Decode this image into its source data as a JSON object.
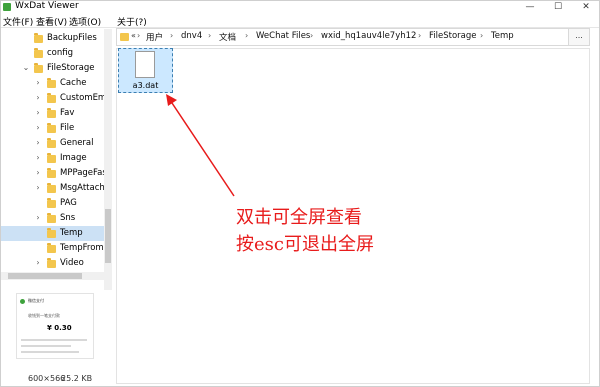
{
  "window": {
    "title": "WxDat Viewer",
    "controls": {
      "minimize": "—",
      "maximize": "☐",
      "close": "✕"
    }
  },
  "menu": [
    {
      "label": "文件(F)"
    },
    {
      "label": "查看(V)"
    },
    {
      "label": "选项(O)"
    },
    {
      "label": "关于(?)"
    }
  ],
  "tree": {
    "items": [
      {
        "label": "BackupFiles",
        "arrow": "",
        "selected": false
      },
      {
        "label": "config",
        "arrow": "",
        "selected": false
      },
      {
        "label": "FileStorage",
        "arrow": "⌄",
        "selected": false
      },
      {
        "label": "Cache",
        "arrow": "›",
        "selected": false
      },
      {
        "label": "CustomEmo",
        "arrow": "›",
        "selected": false
      },
      {
        "label": "Fav",
        "arrow": "›",
        "selected": false
      },
      {
        "label": "File",
        "arrow": "›",
        "selected": false
      },
      {
        "label": "General",
        "arrow": "›",
        "selected": false
      },
      {
        "label": "Image",
        "arrow": "›",
        "selected": false
      },
      {
        "label": "MPPageFas",
        "arrow": "›",
        "selected": false
      },
      {
        "label": "MsgAttach",
        "arrow": "›",
        "selected": false
      },
      {
        "label": "PAG",
        "arrow": "",
        "selected": false
      },
      {
        "label": "Sns",
        "arrow": "›",
        "selected": false
      },
      {
        "label": "Temp",
        "arrow": "",
        "selected": true
      },
      {
        "label": "TempFromP",
        "arrow": "",
        "selected": false
      },
      {
        "label": "Video",
        "arrow": "›",
        "selected": false
      }
    ]
  },
  "preview": {
    "title": "微信支付",
    "line": "收钱到一笔支付款",
    "amount": "¥ 0.30"
  },
  "status": {
    "dimensions": "600×566",
    "size": "25.2 KB"
  },
  "address": {
    "back": "«",
    "segments": [
      "用户",
      "dnv4",
      "文档",
      "WeChat Files",
      "wxid_hq1auv4le7yh12",
      "FileStorage",
      "Temp"
    ],
    "separator": "›",
    "more": "..."
  },
  "files": [
    {
      "name": "a3.dat"
    }
  ],
  "annotation": {
    "line1": "双击可全屏查看",
    "line2": "按esc可退出全屏",
    "color": "#e81b1b"
  }
}
